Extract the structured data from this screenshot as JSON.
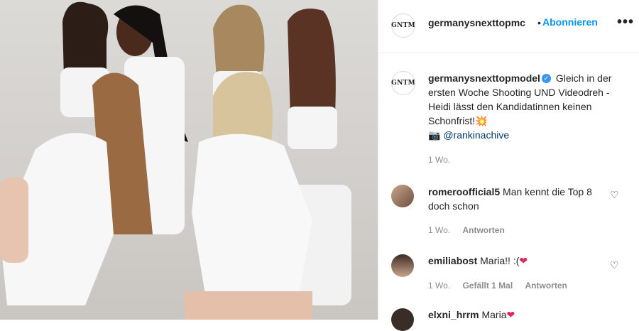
{
  "post": {
    "account": "germanysnexttopmc",
    "separator": "•",
    "follow_label": "Abonnieren",
    "more_label": "•••",
    "logo_text": "GNTM"
  },
  "caption": {
    "username": "germanysnexttopmodel",
    "text_1": "Gleich in der ersten Woche Shooting UND Videodreh - Heidi lässt den Kandidatinnen keinen Schonfrist!",
    "emoji": "💥",
    "camera_emoji": "📷",
    "mention": "@rankinachive",
    "time": "1 Wo."
  },
  "comments": [
    {
      "username": "romeroofficial5",
      "text": "Man kennt die Top 8 doch schon",
      "time": "1 Wo.",
      "likes": "",
      "reply": "Antworten"
    },
    {
      "username": "emiliabost",
      "text": "Maria!! :(",
      "heart": "❤",
      "time": "1 Wo.",
      "likes": "Gefällt 1 Mal",
      "reply": "Antworten"
    },
    {
      "username": "elxni_hrrm",
      "text": "Maria",
      "heart": "❤"
    }
  ],
  "icons": {
    "like": "heart-outline-icon",
    "verified": "verified-badge-icon"
  },
  "colors": {
    "accent": "#0095f6",
    "muted": "#8e8e8e",
    "verified": "#3897f0",
    "heart": "#e0245e"
  }
}
